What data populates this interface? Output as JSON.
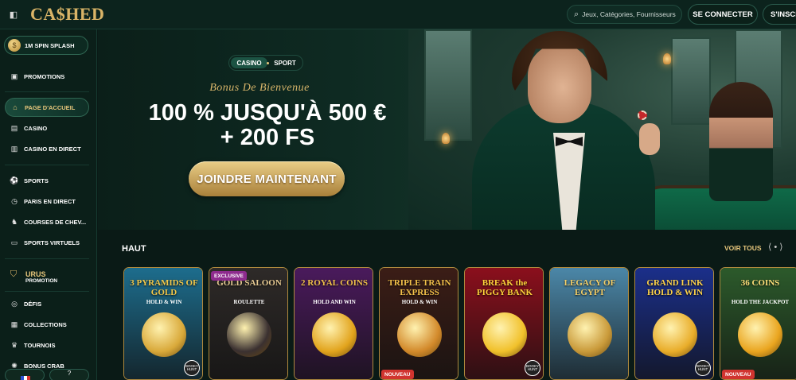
{
  "header": {
    "logo_text": "CA$HED",
    "search_placeholder": "Jeux, Catégories, Fournisseurs",
    "login_label": "SE CONNECTER",
    "signup_label": "S'INSCRIRE"
  },
  "sidebar": {
    "spin_pill": "1M SPIN SPLASH",
    "items": [
      {
        "label": "PROMOTIONS",
        "icon": "gift-icon"
      },
      {
        "label": "PAGE D'ACCUEIL",
        "icon": "home-icon",
        "active": true
      },
      {
        "label": "CASINO",
        "icon": "cards-icon"
      },
      {
        "label": "CASINO EN DIRECT",
        "icon": "live-icon"
      },
      {
        "label": "SPORTS",
        "icon": "ball-icon"
      },
      {
        "label": "PARIS EN DIRECT",
        "icon": "stopwatch-icon"
      },
      {
        "label": "COURSES DE CHEV...",
        "icon": "horse-icon"
      },
      {
        "label": "SPORTS VIRTUELS",
        "icon": "screen-icon"
      },
      {
        "label": "DÉFIS",
        "icon": "target-icon"
      },
      {
        "label": "COLLECTIONS",
        "icon": "collection-icon"
      },
      {
        "label": "TOURNOIS",
        "icon": "trophy-icon"
      },
      {
        "label": "BONUS CRAB",
        "icon": "crab-icon"
      }
    ],
    "urus_title": "URUS",
    "urus_sub": "PROMOTION",
    "help_glyph": "?"
  },
  "hero": {
    "tab_casino": "CASINO",
    "tab_sport": "SPORT",
    "kicker": "Bonus De Bienvenue",
    "title_line1": "100 % JUSQU'À 500 €",
    "title_line2": "+ 200 FS",
    "cta": "JOINDRE MAINTENANT"
  },
  "games_section": {
    "title": "HAUT",
    "see_all": "VOIR TOUS",
    "arrows": "⟨ • ⟩",
    "cards": [
      {
        "title": "3 PYRAMIDS OF GOLD",
        "subtitle": "HOLD & WIN",
        "bg": "#1d6d8d",
        "fg": "#f3c94b",
        "orb": "#d9a93a",
        "tag": "",
        "hunt": "BOOKY HUNT"
      },
      {
        "title": "GOLD SALOON",
        "subtitle": "ROULETTE",
        "bg": "#2e2a28",
        "fg": "#e6c992",
        "orb": "#3a3030",
        "tag": "",
        "top_tag": "EXCLUSIVE",
        "hunt": ""
      },
      {
        "title": "2 ROYAL COINS",
        "subtitle": "HOLD AND WIN",
        "bg": "#4a1a5c",
        "fg": "#f2c24a",
        "orb": "#e2a41d",
        "tag": "",
        "hunt": ""
      },
      {
        "title": "TRIPLE TRAIN EXPRESS",
        "subtitle": "HOLD & WIN",
        "bg": "#3b1d16",
        "fg": "#f3c14a",
        "orb": "#d38a2b",
        "tag": "NOUVEAU",
        "hunt": ""
      },
      {
        "title": "BREAK the PIGGY BANK",
        "subtitle": "",
        "bg": "#8b0f1c",
        "fg": "#ffd33a",
        "orb": "#f1c12b",
        "tag": "",
        "hunt": "BOOKY HUNT"
      },
      {
        "title": "LEGACY OF EGYPT",
        "subtitle": "",
        "bg": "#4b87a8",
        "fg": "#f4d06a",
        "orb": "#c99a3a",
        "tag": "",
        "hunt": ""
      },
      {
        "title": "GRAND LINK HOLD & WIN",
        "subtitle": "",
        "bg": "#1b2f8a",
        "fg": "#ffd44a",
        "orb": "#e9ad2a",
        "tag": "",
        "hunt": "BOOKY HUNT"
      },
      {
        "title": "36 COINS",
        "subtitle": "HOLD THE JACKPOT",
        "bg": "#2c5a2b",
        "fg": "#ffe07a",
        "orb": "#eaa51f",
        "tag": "NOUVEAU",
        "hunt": ""
      }
    ]
  }
}
